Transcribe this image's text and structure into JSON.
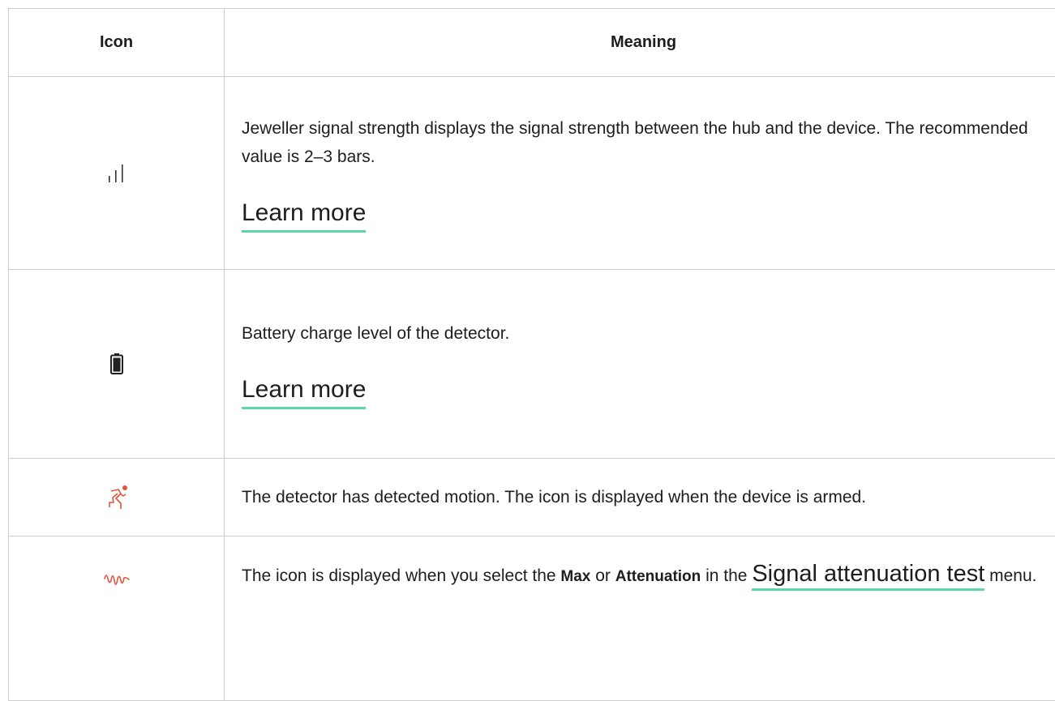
{
  "table": {
    "headers": {
      "icon": "Icon",
      "meaning": "Meaning"
    },
    "rows": [
      {
        "icon_name": "signal-strength-icon",
        "text": "Jeweller signal strength displays the signal strength between the hub and the device. The recommended value is 2–3 bars.",
        "link": "Learn more"
      },
      {
        "icon_name": "battery-icon",
        "text": "Battery charge level of the detector.",
        "link": "Learn more"
      },
      {
        "icon_name": "motion-detected-icon",
        "icon_color": "#e5533f",
        "text": "The detector has detected motion. The icon is displayed when the device is armed."
      },
      {
        "icon_name": "signal-attenuation-icon",
        "icon_color": "#e5533f",
        "text_before": "The icon is displayed when you select the ",
        "bold_1": "Max",
        "text_mid": " or ",
        "bold_2": "Attenuation",
        "text_in": " in the ",
        "link": "Signal attenuation test",
        "text_after": " menu."
      }
    ]
  },
  "link_underline_color": "#5fd6a6"
}
